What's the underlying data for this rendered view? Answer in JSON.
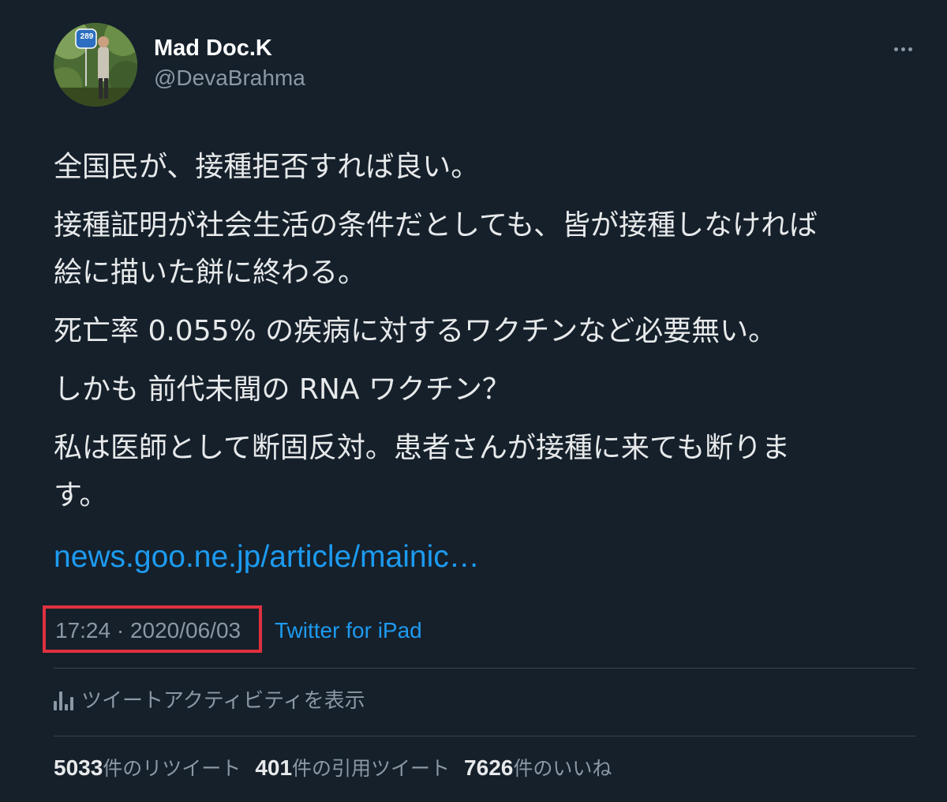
{
  "author": {
    "display_name": "Mad Doc.K",
    "handle": "@DevaBrahma",
    "avatar_sign_text": "289"
  },
  "tweet": {
    "paragraphs": [
      "全国民が、接種拒否すれば良い。",
      "接種証明が社会生活の条件だとしても、皆が接種しなければ\n絵に描いた餅に終わる。",
      "死亡率 0.055% の疾病に対するワクチンなど必要無い。",
      "しかも 前代未聞の RNA ワクチン？",
      "私は医師として断固反対。患者さんが接種に来ても断りま\nす。"
    ],
    "link": "news.goo.ne.jp/article/mainic…",
    "timestamp": "17:24 · 2020/06/03",
    "source": "Twitter for iPad"
  },
  "activity": {
    "label": "ツイートアクティビティを表示",
    "icon": "bar-chart-icon"
  },
  "stats": {
    "retweets_count": "5033",
    "retweets_label": "件のリツイート",
    "quotes_count": "401",
    "quotes_label": "件の引用ツイート",
    "likes_count": "7626",
    "likes_label": "件のいいね"
  },
  "colors": {
    "background": "#15202b",
    "link": "#1d9bf0",
    "secondary_text": "#8b98a5",
    "highlight_box": "#e0303f",
    "divider": "#38444d"
  }
}
